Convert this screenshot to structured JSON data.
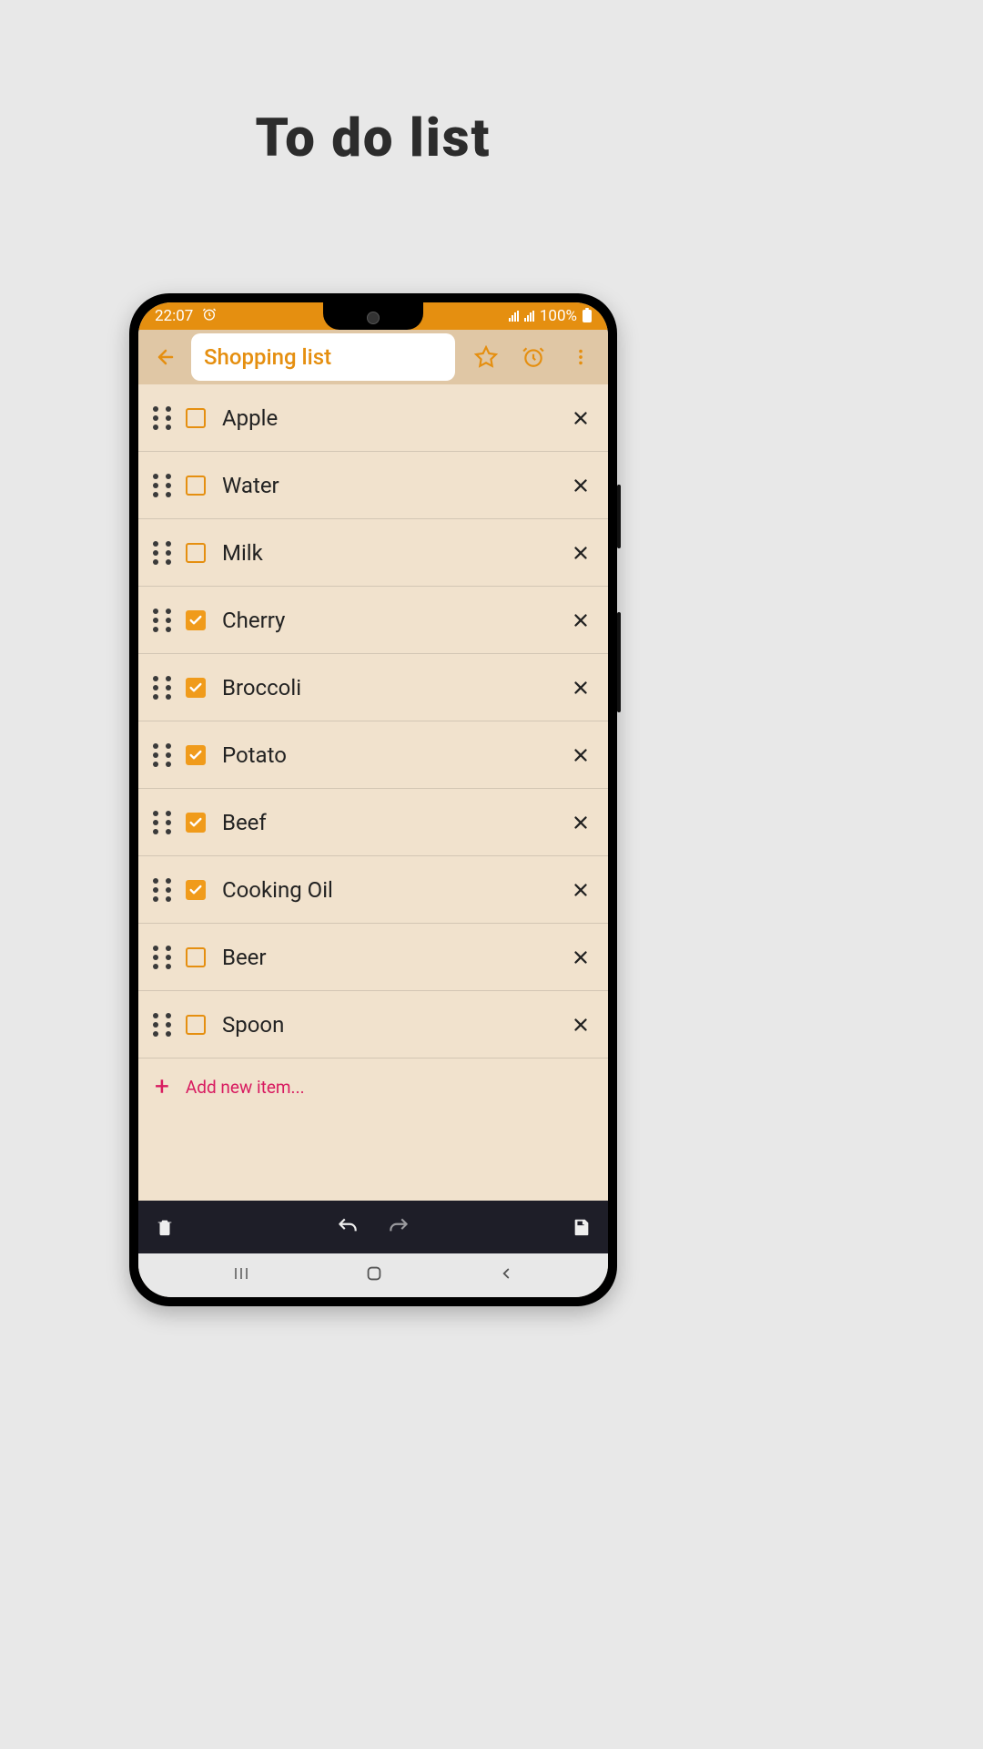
{
  "page": {
    "heading": "To do list"
  },
  "status_bar": {
    "time": "22:07",
    "battery_text": "100%"
  },
  "toolbar": {
    "title": "Shopping list"
  },
  "list": {
    "items": [
      {
        "label": "Apple",
        "checked": false
      },
      {
        "label": "Water",
        "checked": false
      },
      {
        "label": "Milk",
        "checked": false
      },
      {
        "label": "Cherry",
        "checked": true
      },
      {
        "label": "Broccoli",
        "checked": true
      },
      {
        "label": "Potato",
        "checked": true
      },
      {
        "label": "Beef",
        "checked": true
      },
      {
        "label": "Cooking Oil",
        "checked": true
      },
      {
        "label": "Beer",
        "checked": false
      },
      {
        "label": "Spoon",
        "checked": false
      }
    ]
  },
  "add_row": {
    "label": "Add new item..."
  },
  "colors": {
    "accent": "#e58f10",
    "check": "#f09b1b",
    "add": "#d81b60"
  }
}
